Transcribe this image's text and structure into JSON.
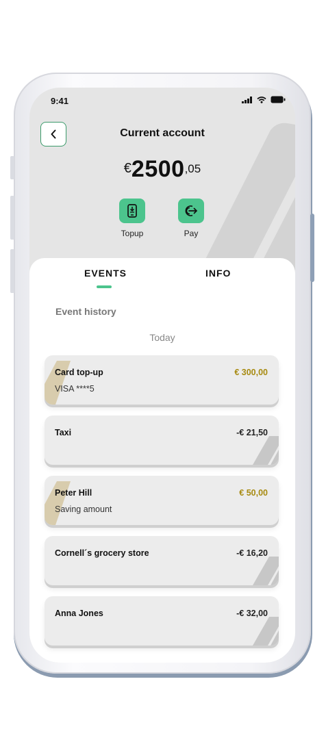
{
  "status": {
    "time": "9:41"
  },
  "header": {
    "title": "Current account"
  },
  "balance": {
    "currency": "€",
    "whole": "2500",
    "decimals": ",05"
  },
  "actions": [
    {
      "label": "Topup",
      "icon": "phone-topup-icon"
    },
    {
      "label": "Pay",
      "icon": "pay-arrow-icon"
    }
  ],
  "tabs": [
    {
      "label": "EVENTS",
      "active": true
    },
    {
      "label": "INFO",
      "active": false
    }
  ],
  "events": {
    "section_title": "Event history",
    "day_label": "Today",
    "items": [
      {
        "name": "Card top-up",
        "detail": "VISA ****5",
        "amount": "€ 300,00",
        "kind": "credit"
      },
      {
        "name": "Taxi",
        "detail": "",
        "amount": "-€ 21,50",
        "kind": "debit"
      },
      {
        "name": "Peter Hill",
        "detail": "Saving amount",
        "amount": "€ 50,00",
        "kind": "credit"
      },
      {
        "name": "Cornell´s grocery store",
        "detail": "",
        "amount": "-€ 16,20",
        "kind": "debit"
      },
      {
        "name": "Anna Jones",
        "detail": "",
        "amount": "-€ 32,00",
        "kind": "debit"
      }
    ]
  },
  "colors": {
    "accent": "#4cc48d",
    "credit": "#a78a10",
    "debit": "#222222",
    "back_border": "#3b9a6a"
  }
}
